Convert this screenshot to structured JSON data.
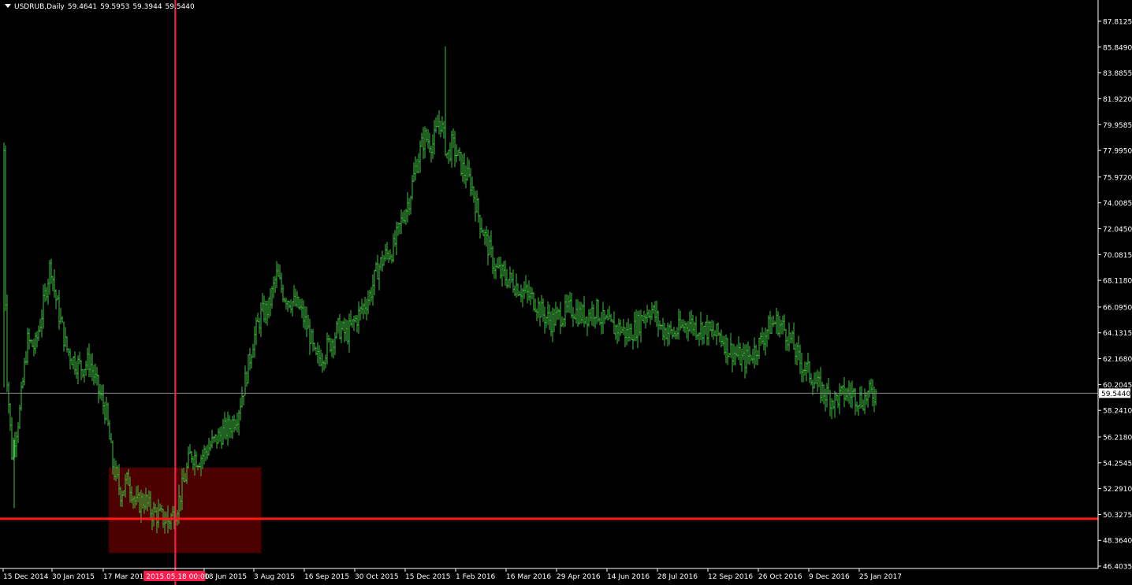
{
  "header": {
    "symbol": "USDRUB,Daily",
    "open": "59.4641",
    "high": "59.5953",
    "low": "59.3944",
    "close": "59.5440"
  },
  "price_label": "59.5440",
  "crosshair_label": "2015.05.18 00:00",
  "colors": {
    "background": "#000000",
    "bars": "#3fbf3f",
    "axis": "#ffffff",
    "hline": "#ff1a1a",
    "vline": "#ff1a4a",
    "box": "#4d0000",
    "price_line": "#8c8c8c"
  },
  "chart_data": {
    "type": "line",
    "title": "USDRUB,Daily",
    "ylim": [
      46.4035,
      88.8
    ],
    "y_ticks": [
      "87.8125",
      "85.8490",
      "83.8855",
      "81.9220",
      "79.9585",
      "77.9950",
      "75.9720",
      "74.0085",
      "72.0450",
      "70.0815",
      "68.1180",
      "66.0950",
      "64.1315",
      "62.1680",
      "60.2045",
      "58.2410",
      "56.2180",
      "54.2545",
      "52.2910",
      "50.3275",
      "48.3640",
      "46.4035"
    ],
    "x_ticks": [
      "15 Dec 2014",
      "30 Jan 2015",
      "17 Mar 2015",
      "18 Jun 2015",
      "3 Aug 2015",
      "16 Sep 2015",
      "30 Oct 2015",
      "15 Dec 2015",
      "1 Feb 2016",
      "16 Mar 2016",
      "29 Apr 2016",
      "14 Jun 2016",
      "28 Jul 2016",
      "12 Sep 2016",
      "26 Oct 2016",
      "9 Dec 2016",
      "25 Jan 2017"
    ],
    "series": [
      {
        "x": [
          "2014-12-15",
          "2014-12-17",
          "2014-12-22",
          "2014-12-29",
          "2015-01-05",
          "2015-01-12",
          "2015-01-19",
          "2015-01-26",
          "2015-01-30",
          "2015-02-09",
          "2015-02-16",
          "2015-02-23",
          "2015-03-02",
          "2015-03-09",
          "2015-03-17",
          "2015-03-23",
          "2015-03-30",
          "2015-04-06",
          "2015-04-13",
          "2015-04-20",
          "2015-04-27",
          "2015-05-04",
          "2015-05-11",
          "2015-05-18",
          "2015-05-25",
          "2015-06-01",
          "2015-06-08",
          "2015-06-18",
          "2015-06-29",
          "2015-07-06",
          "2015-07-13",
          "2015-07-20",
          "2015-07-27",
          "2015-08-03",
          "2015-08-10",
          "2015-08-17",
          "2015-08-24",
          "2015-08-31",
          "2015-09-07",
          "2015-09-16",
          "2015-09-21",
          "2015-09-28",
          "2015-10-05",
          "2015-10-12",
          "2015-10-19",
          "2015-10-30",
          "2015-11-09",
          "2015-11-16",
          "2015-11-23",
          "2015-11-30",
          "2015-12-07",
          "2015-12-15",
          "2015-12-21",
          "2015-12-28",
          "2016-01-05",
          "2016-01-11",
          "2016-01-18",
          "2016-01-22",
          "2016-02-01",
          "2016-02-08",
          "2016-02-15",
          "2016-02-22",
          "2016-03-01",
          "2016-03-08",
          "2016-03-16",
          "2016-03-23",
          "2016-03-30",
          "2016-04-06",
          "2016-04-13",
          "2016-04-20",
          "2016-04-29",
          "2016-05-09",
          "2016-05-16",
          "2016-05-23",
          "2016-05-30",
          "2016-06-06",
          "2016-06-14",
          "2016-06-21",
          "2016-06-28",
          "2016-07-05",
          "2016-07-12",
          "2016-07-19",
          "2016-07-28",
          "2016-08-08",
          "2016-08-15",
          "2016-08-22",
          "2016-08-29",
          "2016-09-05",
          "2016-09-12",
          "2016-09-19",
          "2016-09-26",
          "2016-10-03",
          "2016-10-10",
          "2016-10-17",
          "2016-10-26",
          "2016-11-01",
          "2016-11-08",
          "2016-11-15",
          "2016-11-22",
          "2016-11-29",
          "2016-12-09",
          "2016-12-16",
          "2016-12-23",
          "2016-12-30",
          "2017-01-09",
          "2017-01-16",
          "2017-01-25",
          "2017-01-31",
          "2017-02-06"
        ],
        "y": [
          78.0,
          62.0,
          55.0,
          58.0,
          63.5,
          63.0,
          66.0,
          69.5,
          67.0,
          63.0,
          62.0,
          61.5,
          62.0,
          60.0,
          58.0,
          54.0,
          52.0,
          53.0,
          51.0,
          51.5,
          50.5,
          50.2,
          49.8,
          50.5,
          52.5,
          55.0,
          54.5,
          55.5,
          56.5,
          57.0,
          58.0,
          60.5,
          63.5,
          65.5,
          66.0,
          68.5,
          67.0,
          66.5,
          66.0,
          64.0,
          62.0,
          62.5,
          63.5,
          64.5,
          64.0,
          65.5,
          67.0,
          69.0,
          70.0,
          70.5,
          72.5,
          74.5,
          77.0,
          79.0,
          78.5,
          80.5,
          77.5,
          78.5,
          76.5,
          75.5,
          73.0,
          71.0,
          69.0,
          68.5,
          68.0,
          67.5,
          67.0,
          66.5,
          65.5,
          65.0,
          65.5,
          66.0,
          65.5,
          65.5,
          66.0,
          65.0,
          64.5,
          64.5,
          64.0,
          64.5,
          65.5,
          66.0,
          64.5,
          64.0,
          64.5,
          65.0,
          64.5,
          64.5,
          64.0,
          64.0,
          63.0,
          62.5,
          62.0,
          62.5,
          63.5,
          64.5,
          65.0,
          64.5,
          63.5,
          62.0,
          61.0,
          60.0,
          59.5,
          59.0,
          59.5,
          59.5,
          59.0,
          59.5,
          59.54
        ]
      }
    ],
    "annotations": {
      "horizontal_line": 50.0,
      "vertical_line": "2015-05-18",
      "shaded_zone": {
        "x_start": "2015-03-17",
        "x_end": "2015-08-03",
        "y_low": 47.4,
        "y_high": 53.9
      },
      "current_price": 59.544
    }
  }
}
